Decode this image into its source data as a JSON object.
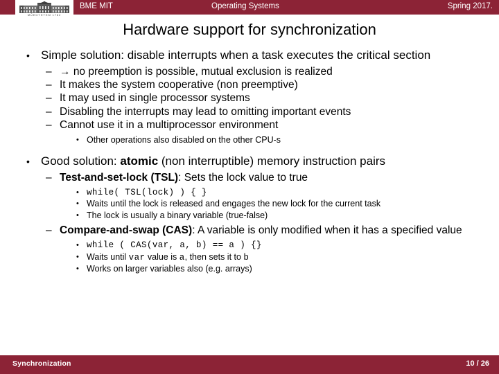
{
  "header": {
    "logo_icon": "bme-building-logo-icon",
    "logo_caption": "MŰEGYETEM 1782",
    "left_label": "BME MIT",
    "center_label": "Operating Systems",
    "right_label": "Spring 2017."
  },
  "title": "Hardware support for synchronization",
  "content": {
    "bullet1": {
      "marker": "•",
      "text": "Simple solution: disable interrupts when a task executes the critical section"
    },
    "bullet1_subs": [
      {
        "marker": "–",
        "arrow": "→",
        "text": "no preemption is possible, mutual exclusion is realized"
      },
      {
        "marker": "–",
        "text": "It makes the system cooperative (non preemptive)"
      },
      {
        "marker": "–",
        "text": "It may used in single processor systems"
      },
      {
        "marker": "–",
        "text": "Disabling the interrupts may lead to omitting important events"
      },
      {
        "marker": "–",
        "text": "Cannot use it in a multiprocessor environment"
      }
    ],
    "bullet1_sub_sub": {
      "marker": "•",
      "text": "Other operations also disabled on the other CPU-s"
    },
    "bullet2": {
      "marker": "•",
      "text_before": "Good solution: ",
      "bold": "atomic",
      "text_after": " (non interruptible) memory instruction pairs"
    },
    "tsl": {
      "marker": "–",
      "bold": "Test-and-set-lock (TSL)",
      "rest": ": Sets the lock value to true",
      "items": [
        {
          "marker": "•",
          "code": "while( TSL(lock) ) { }"
        },
        {
          "marker": "•",
          "text": "Waits until the lock is released and engages the new lock for the current task"
        },
        {
          "marker": "•",
          "text": "The lock is usually a binary variable (true-false)"
        }
      ]
    },
    "cas": {
      "marker": "–",
      "bold": "Compare-and-swap (CAS)",
      "rest": ": A variable is only modified when it has a specified value",
      "items": [
        {
          "marker": "•",
          "code": "while ( CAS(var, a, b) == a ) {}"
        },
        {
          "marker": "•",
          "part1": "Waits until ",
          "code1": "var",
          "part2": " value is ",
          "code2": "a",
          "part3": ", then sets it to ",
          "code3": "b"
        },
        {
          "marker": "•",
          "text": "Works on larger variables also (e.g. arrays)"
        }
      ]
    }
  },
  "footer": {
    "left_label": "Synchronization",
    "page_label": "10 / 26"
  },
  "colors": {
    "brand_maroon": "#8C2336",
    "text": "#000000",
    "header_text": "#FFFFFF"
  }
}
